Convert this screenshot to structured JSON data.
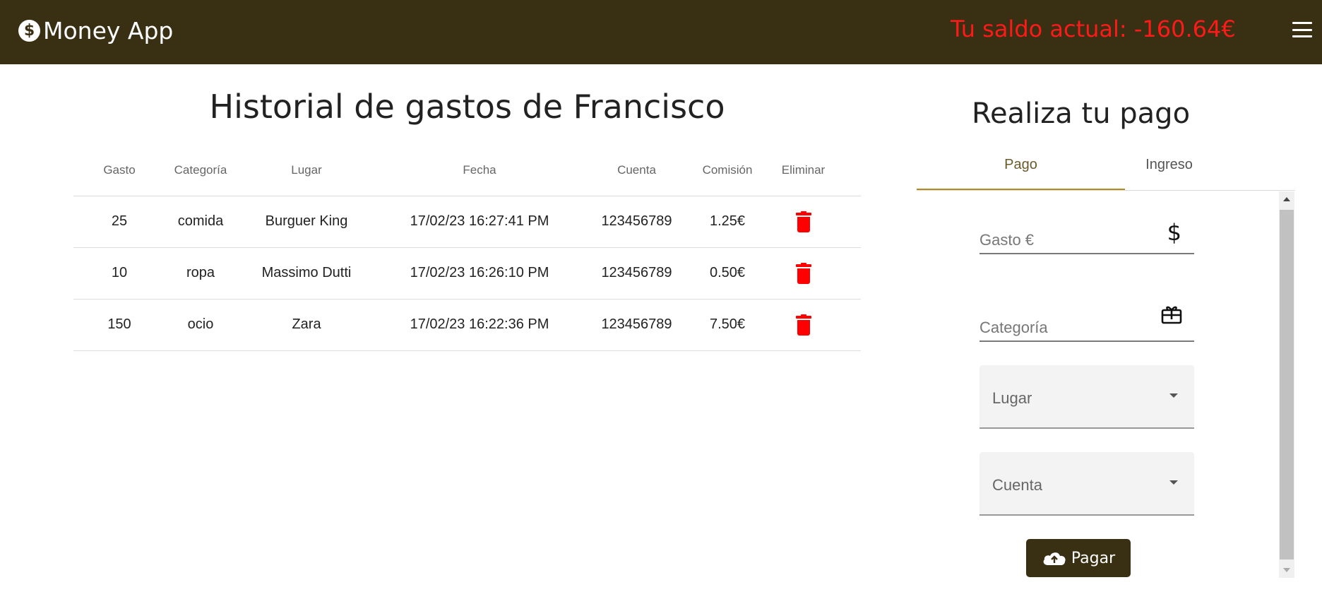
{
  "header": {
    "app_title": "Money App",
    "logo_glyph": "$",
    "balance_text": "Tu saldo actual: -160.64€",
    "balance_color": "#ff1a1a",
    "brand_color": "#392f12",
    "menu_icon": "hamburger-menu-icon"
  },
  "history": {
    "title": "Historial de gastos de Francisco",
    "columns": [
      "Gasto",
      "Categoría",
      "Lugar",
      "Fecha",
      "Cuenta",
      "Comisión",
      "Eliminar"
    ],
    "rows": [
      {
        "gasto": "25",
        "categoria": "comida",
        "lugar": "Burguer King",
        "fecha": "17/02/23 16:27:41 PM",
        "cuenta": "123456789",
        "comision": "1.25€"
      },
      {
        "gasto": "10",
        "categoria": "ropa",
        "lugar": "Massimo Dutti",
        "fecha": "17/02/23 16:26:10 PM",
        "cuenta": "123456789",
        "comision": "0.50€"
      },
      {
        "gasto": "150",
        "categoria": "ocio",
        "lugar": "Zara",
        "fecha": "17/02/23 16:22:36 PM",
        "cuenta": "123456789",
        "comision": "7.50€"
      }
    ],
    "delete_icon": "trash-icon",
    "delete_color": "#ff0000"
  },
  "payment": {
    "title": "Realiza tu pago",
    "tabs": [
      {
        "label": "Pago",
        "active": true
      },
      {
        "label": "Ingreso",
        "active": false
      }
    ],
    "fields": {
      "gasto": {
        "label": "Gasto €",
        "icon": "dollar-icon",
        "icon_glyph": "$"
      },
      "categoria": {
        "label": "Categoría",
        "icon": "gift-card-icon"
      },
      "lugar": {
        "label": "Lugar",
        "icon": "dropdown-caret-icon"
      },
      "cuenta": {
        "label": "Cuenta",
        "icon": "dropdown-caret-icon"
      }
    },
    "submit": {
      "label": "Pagar",
      "icon": "cloud-upload-icon"
    },
    "accent_color": "#b58a1c"
  }
}
